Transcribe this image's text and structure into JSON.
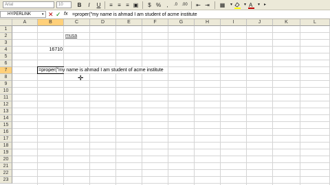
{
  "toolbar": {
    "font_name": "Arial",
    "font_size": "10",
    "bold": "B",
    "italic": "I",
    "underline": "U"
  },
  "formula_bar": {
    "name_box": "HYPERLINK",
    "cancel_icon": "✕",
    "enter_icon": "✓",
    "fx_label": "fx",
    "formula": "=proper(\"my name is ahmad I am student of acme institute"
  },
  "columns": [
    "A",
    "B",
    "C",
    "D",
    "E",
    "F",
    "G",
    "H",
    "I",
    "J",
    "K",
    "L"
  ],
  "rows": [
    "1",
    "2",
    "3",
    "4",
    "5",
    "6",
    "7",
    "8",
    "9",
    "10",
    "11",
    "12",
    "13",
    "14",
    "15",
    "16",
    "17",
    "18",
    "19",
    "20",
    "21",
    "22",
    "23"
  ],
  "cells": {
    "c2": "musa",
    "b4": "16710",
    "b7": "=proper(\"my name is ahmad I am student of acme institute"
  },
  "colors": {
    "selected_header": "#ffd07a",
    "chrome": "#ece9d8",
    "font_color_swatch": "#c00000",
    "fill_swatch": "#ffff00"
  }
}
